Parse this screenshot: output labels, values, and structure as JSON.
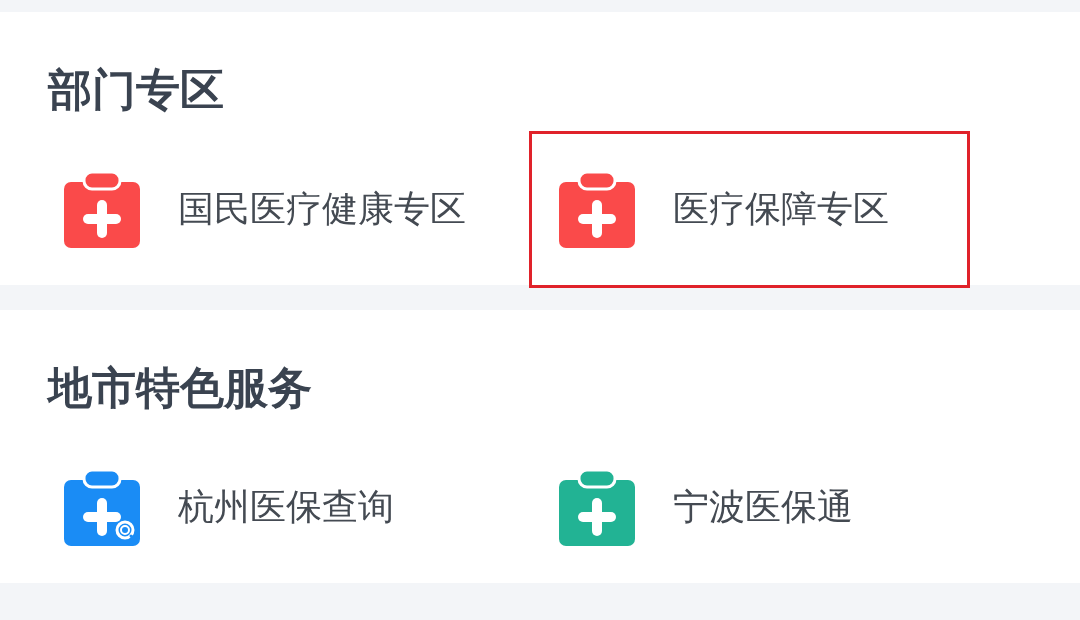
{
  "sections": [
    {
      "title": "部门专区",
      "items": [
        {
          "label": "国民医疗健康专区",
          "kind": "clipboard",
          "color": "#fa4a4a",
          "highlighted": false
        },
        {
          "label": "医疗保障专区",
          "kind": "clipboard",
          "color": "#fa4a4a",
          "highlighted": true
        }
      ]
    },
    {
      "title": "地市特色服务",
      "items": [
        {
          "label": "杭州医保查询",
          "kind": "clipboard-search",
          "color": "#1a8cf5",
          "highlighted": false
        },
        {
          "label": "宁波医保通",
          "kind": "clipboard",
          "color": "#22b394",
          "highlighted": false
        }
      ]
    }
  ]
}
